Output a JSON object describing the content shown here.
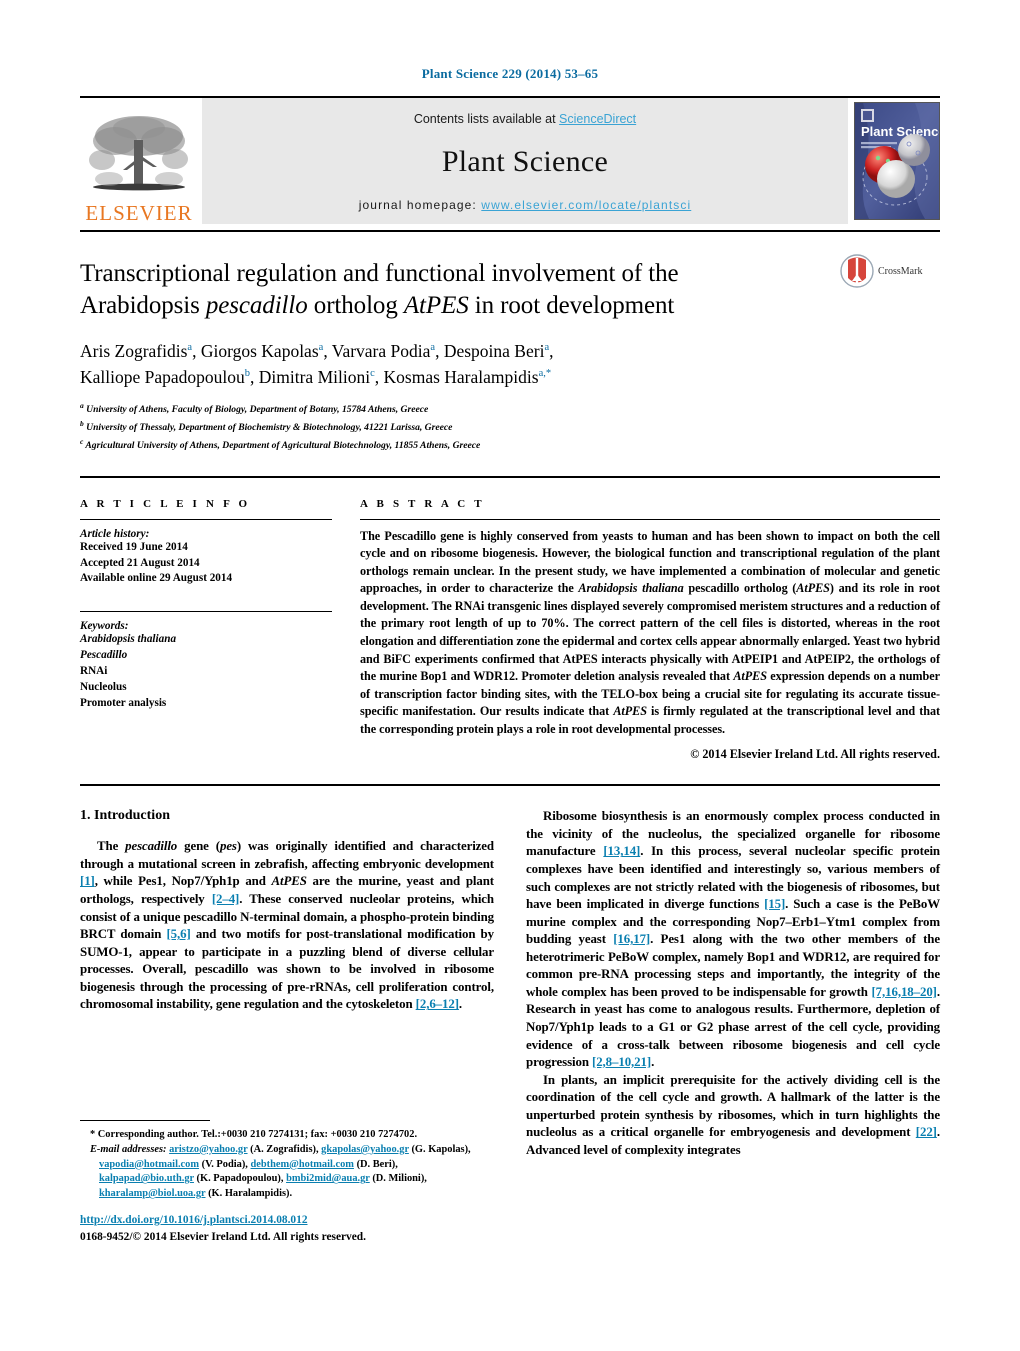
{
  "running_head": "Plant Science 229 (2014) 53–65",
  "masthead": {
    "publisher_name": "ELSEVIER",
    "contents_prefix": "Contents lists available at ",
    "contents_link": "ScienceDirect",
    "journal_name": "Plant Science",
    "homepage_prefix": "journal homepage: ",
    "homepage_url": "www.elsevier.com/locate/plantsci",
    "cover_title": "Plant Science",
    "accent_link_color": "#3aa3d4",
    "publisher_color": "#e87722",
    "band_color": "#e8e8e8"
  },
  "article": {
    "title_line1_a": "Transcriptional regulation and functional involvement of the",
    "title_line2_a": "Arabidopsis ",
    "title_line2_it1": "pescadillo",
    "title_line2_b": " ortholog ",
    "title_line2_it2": "AtPES",
    "title_line2_c": " in root development",
    "crossmark_label": "CrossMark",
    "authors_line1": "Aris Zografidis",
    "authors": [
      {
        "name": "Aris Zografidis",
        "sup": "a",
        "sep": ", "
      },
      {
        "name": "Giorgos Kapolas",
        "sup": "a",
        "sep": ", "
      },
      {
        "name": "Varvara Podia",
        "sup": "a",
        "sep": ", "
      },
      {
        "name": "Despoina Beri",
        "sup": "a",
        "sep": ","
      },
      {
        "name": "Kalliope Papadopoulou",
        "sup": "b",
        "sep": ", "
      },
      {
        "name": "Dimitra Milioni",
        "sup": "c",
        "sep": ", "
      },
      {
        "name": "Kosmas Haralampidis",
        "sup": "a,*",
        "sep": ""
      }
    ],
    "affiliations": [
      {
        "sup": "a",
        "text": "University of Athens, Faculty of Biology, Department of Botany, 15784 Athens, Greece"
      },
      {
        "sup": "b",
        "text": "University of Thessaly, Department of Biochemistry & Biotechnology, 41221 Larissa, Greece"
      },
      {
        "sup": "c",
        "text": "Agricultural University of Athens, Department of Agricultural Biotechnology, 11855 Athens, Greece"
      }
    ]
  },
  "article_info": {
    "heading": "A R T I C L E   I N F O",
    "history_label": "Article history:",
    "history": [
      "Received 19 June 2014",
      "Accepted 21 August 2014",
      "Available online 29 August 2014"
    ],
    "keywords_label": "Keywords:",
    "keywords": [
      {
        "text": "Arabidopsis thaliana",
        "italic": true
      },
      {
        "text": "Pescadillo",
        "italic": true
      },
      {
        "text": "RNAi",
        "italic": false
      },
      {
        "text": "Nucleolus",
        "italic": false
      },
      {
        "text": "Promoter analysis",
        "italic": false
      }
    ]
  },
  "abstract": {
    "heading": "A B S T R A C T",
    "p1a": "The Pescadillo gene is highly conserved from yeasts to human and has been shown to impact on both the cell cycle and on ribosome biogenesis. However, the biological function and transcriptional regulation of the plant orthologs remain unclear. In the present study, we have implemented a combination of molecular and genetic approaches, in order to characterize the ",
    "it1": "Arabidopsis thaliana",
    "p1b": " pescadillo ortholog (",
    "it2": "AtPES",
    "p1c": ") and its role in root development. The RNAi transgenic lines displayed severely compromised meristem structures and a reduction of the primary root length of up to 70%. The correct pattern of the cell files is distorted, whereas in the root elongation and differentiation zone the epidermal and cortex cells appear abnormally enlarged. Yeast two hybrid and BiFC experiments confirmed that AtPES interacts physically with AtPEIP1 and AtPEIP2, the orthologs of the murine Bop1 and WDR12. Promoter deletion analysis revealed that ",
    "it3": "AtPES",
    "p1d": " expression depends on a number of transcription factor binding sites, with the TELO-box being a crucial site for regulating its accurate tissue-specific manifestation. Our results indicate that ",
    "it4": "AtPES",
    "p1e": " is firmly regulated at the transcriptional level and that the corresponding protein plays a role in root developmental processes.",
    "copyright": "© 2014 Elsevier Ireland Ltd. All rights reserved."
  },
  "body": {
    "section_number_title": "1.  Introduction",
    "left_p1_a": "The ",
    "left_p1_it1": "pescadillo",
    "left_p1_b": " gene (",
    "left_p1_it2": "pes",
    "left_p1_c": ") was originally identified and characterized through a mutational screen in zebrafish, affecting embryonic development ",
    "left_p1_ref1": "[1]",
    "left_p1_d": ", while Pes1, Nop7/Yph1p and ",
    "left_p1_it3": "AtPES",
    "left_p1_e": " are the murine, yeast and plant orthologs, respectively ",
    "left_p1_ref2": "[2–4]",
    "left_p1_f": ". These conserved nucleolar proteins, which consist of a unique pescadillo N-terminal domain, a phospho-protein binding BRCT domain ",
    "left_p1_ref3": "[5,6]",
    "left_p1_g": " and two motifs for post-translational modification by SUMO-1, appear to participate in a puzzling blend of diverse cellular processes. Overall, pescadillo was shown to be involved in ribosome biogenesis through the processing of pre-rRNAs, cell proliferation control, chromosomal instability, gene regulation and the cytoskeleton ",
    "left_p1_ref4": "[2,6–12]",
    "left_p1_h": ".",
    "right_p1_a": "Ribosome biosynthesis is an enormously complex process conducted in the vicinity of the nucleolus, the specialized organelle for ribosome manufacture ",
    "right_p1_ref1": "[13,14]",
    "right_p1_b": ". In this process, several nucleolar specific protein complexes have been identified and interestingly so, various members of such complexes are not strictly related with the biogenesis of ribosomes, but have been implicated in diverge functions ",
    "right_p1_ref2": "[15]",
    "right_p1_c": ". Such a case is the PeBoW murine complex and the corresponding Nop7–Erb1–Ytm1 complex from budding yeast ",
    "right_p1_ref3": "[16,17]",
    "right_p1_d": ". Pes1 along with the two other members of the heterotrimeric PeBoW complex, namely Bop1 and WDR12, are required for common pre-RNA processing steps and importantly, the integrity of the whole complex has been proved to be indispensable for growth ",
    "right_p1_ref4": "[7,16,18–20]",
    "right_p1_e": ". Research in yeast has come to analogous results. Furthermore, depletion of Nop7/Yph1p leads to a G1 or G2 phase arrest of the cell cycle, providing evidence of a cross-talk between ribosome biogenesis and cell cycle progression ",
    "right_p1_ref5": "[2,8–10,21]",
    "right_p1_f": ".",
    "right_p2_a": "In plants, an implicit prerequisite for the actively dividing cell is the coordination of the cell cycle and growth. A hallmark of the latter is the unperturbed protein synthesis by ribosomes, which in turn highlights the nucleolus as a critical organelle for embryogenesis and development ",
    "right_p2_ref1": "[22]",
    "right_p2_b": ". Advanced level of complexity integrates"
  },
  "footnotes": {
    "corresponding": "*  Corresponding author. Tel.:+0030 210 7274131; fax: +0030 210 7274702.",
    "email_label": "E-mail addresses:",
    "emails": [
      {
        "address": "aristzo@yahoo.gr",
        "owner": " (A. Zografidis), "
      },
      {
        "address": "gkapolas@yahoo.gr",
        "owner": " (G. Kapolas), "
      },
      {
        "address": "vapodia@hotmail.com",
        "owner": " (V. Podia), "
      },
      {
        "address": "debthem@hotmail.com",
        "owner": " (D. Beri), "
      },
      {
        "address": "kalpapad@bio.uth.gr",
        "owner": " (K. Papadopoulou), "
      },
      {
        "address": "bmbi2mid@aua.gr",
        "owner": " (D. Milioni), "
      },
      {
        "address": "kharalamp@biol.uoa.gr",
        "owner": " (K. Haralampidis)."
      }
    ],
    "doi": "http://dx.doi.org/10.1016/j.plantsci.2014.08.012",
    "issn": "0168-9452/© 2014 Elsevier Ireland Ltd. All rights reserved."
  }
}
